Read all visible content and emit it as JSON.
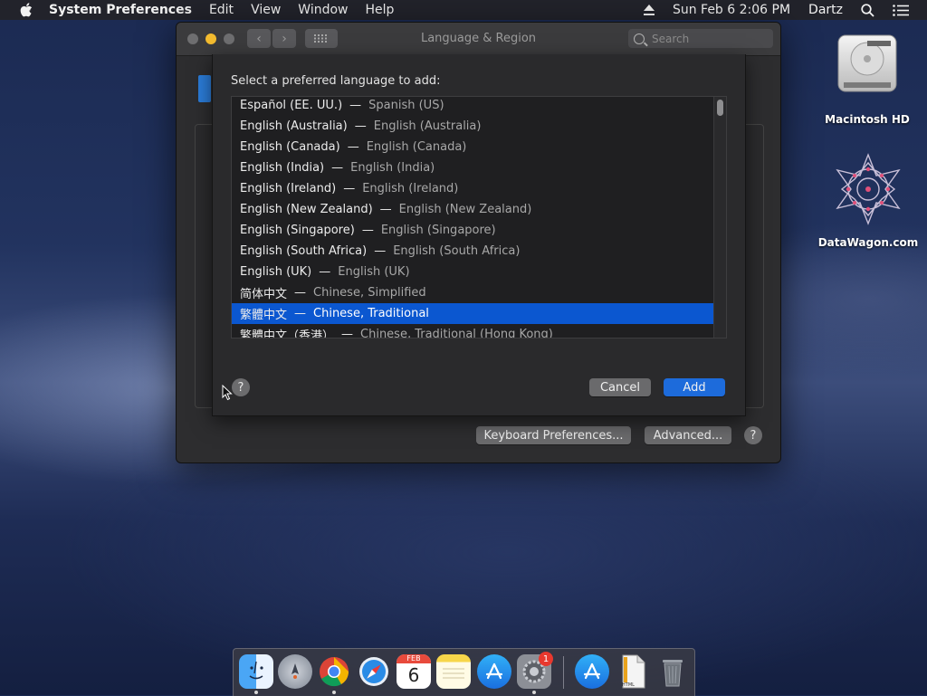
{
  "menubar": {
    "app_name": "System Preferences",
    "items": [
      "Edit",
      "View",
      "Window",
      "Help"
    ],
    "datetime": "Sun Feb 6  2:06 PM",
    "user": "Dartz"
  },
  "window": {
    "title": "Language & Region",
    "search_placeholder": "Search",
    "keyboard_prefs_label": "Keyboard Preferences...",
    "advanced_label": "Advanced...",
    "help_label": "?"
  },
  "sheet": {
    "prompt": "Select a preferred language to add:",
    "languages": [
      {
        "native": "Español (EE. UU.)",
        "english": "Spanish (US)"
      },
      {
        "native": "English (Australia)",
        "english": "English (Australia)"
      },
      {
        "native": "English (Canada)",
        "english": "English (Canada)"
      },
      {
        "native": "English (India)",
        "english": "English (India)"
      },
      {
        "native": "English (Ireland)",
        "english": "English (Ireland)"
      },
      {
        "native": "English (New Zealand)",
        "english": "English (New Zealand)"
      },
      {
        "native": "English (Singapore)",
        "english": "English (Singapore)"
      },
      {
        "native": "English (South Africa)",
        "english": "English (South Africa)"
      },
      {
        "native": "English (UK)",
        "english": "English (UK)"
      },
      {
        "native": "简体中文",
        "english": "Chinese, Simplified"
      },
      {
        "native": "繁體中文",
        "english": "Chinese, Traditional"
      },
      {
        "native": "繁體中文（香港）",
        "english": "Chinese, Traditional (Hong Kong)"
      }
    ],
    "dash": "—",
    "selected_index": 10,
    "cancel_label": "Cancel",
    "add_label": "Add",
    "help_label": "?"
  },
  "desktop": {
    "icons": [
      {
        "label": "Macintosh HD"
      },
      {
        "label": "DataWagon.com"
      }
    ]
  },
  "dock": {
    "apps": [
      "finder-icon",
      "launchpad-icon",
      "chrome-icon",
      "safari-icon",
      "calendar-icon",
      "notes-icon",
      "app-store-icon",
      "system-preferences-icon",
      "app-store-folder-icon",
      "html-file-icon",
      "trash-icon"
    ],
    "calendar_month": "FEB",
    "calendar_day": "6",
    "badge_count": "1",
    "file_label": "HTML"
  },
  "colors": {
    "selection": "#0b57d0",
    "add_button": "#1d6bdb",
    "close_light": "#6e6e70",
    "minimize_light": "#f3bb2f",
    "zoom_light": "#6e6e70"
  }
}
